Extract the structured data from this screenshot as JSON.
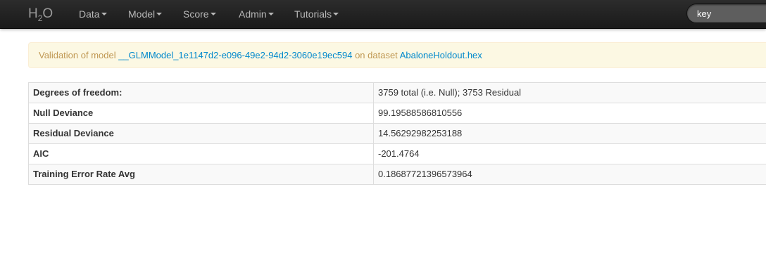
{
  "navbar": {
    "brand_main": "H",
    "brand_sub": "2",
    "brand_end": "O",
    "menus": [
      "Data",
      "Model",
      "Score",
      "Admin",
      "Tutorials"
    ],
    "search_value": "key"
  },
  "alert": {
    "prefix": "Validation of model ",
    "model_link": "__GLMModel_1e1147d2-e096-49e2-94d2-3060e19ec594",
    "middle": " on dataset ",
    "dataset_link": "AbaloneHoldout.hex"
  },
  "stats": [
    {
      "label": "Degrees of freedom:",
      "value": "3759 total (i.e. Null); 3753 Residual"
    },
    {
      "label": "Null Deviance",
      "value": "99.19588586810556"
    },
    {
      "label": "Residual Deviance",
      "value": "14.56292982253188"
    },
    {
      "label": "AIC",
      "value": "-201.4764"
    },
    {
      "label": "Training Error Rate Avg",
      "value": "0.18687721396573964"
    }
  ],
  "colors": {
    "navbar": "#1f1f1f",
    "alert_bg": "#fcf8e3",
    "alert_text": "#c09853",
    "link": "#0088cc"
  }
}
